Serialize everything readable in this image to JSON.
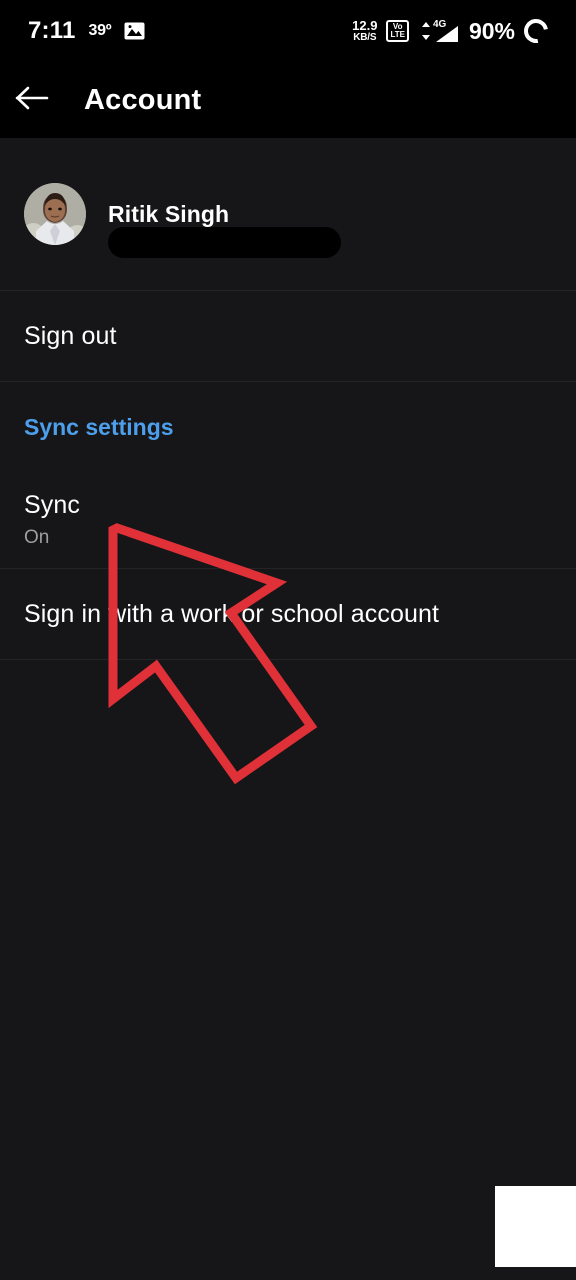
{
  "status_bar": {
    "time": "7:11",
    "temperature": "39º",
    "photo_icon": "image-icon",
    "network_speed_value": "12.9",
    "network_speed_unit": "KB/S",
    "volte_top": "Vo",
    "volte_bottom": "LTE",
    "signal_label": "4G",
    "battery_percent": "90%",
    "battery_icon": "battery-charging-ring-icon"
  },
  "app_bar": {
    "back_icon": "back-arrow-icon",
    "title": "Account"
  },
  "profile": {
    "avatar_alt": "user-avatar",
    "name": "Ritik Singh",
    "email_redacted": ""
  },
  "rows": {
    "sign_out": "Sign out",
    "sync_settings_header": "Sync settings",
    "sync_title": "Sync",
    "sync_subtitle": "On",
    "work_school": "Sign in with a work or school account"
  },
  "annotation": {
    "arrow_color": "#E03038",
    "arrow_name": "red-pointer-arrow"
  },
  "colors": {
    "background": "#161618",
    "bar_background": "#000000",
    "accent_blue": "#4D9FEC",
    "muted_text": "#9E9E9E",
    "annotation_red": "#E03038"
  }
}
